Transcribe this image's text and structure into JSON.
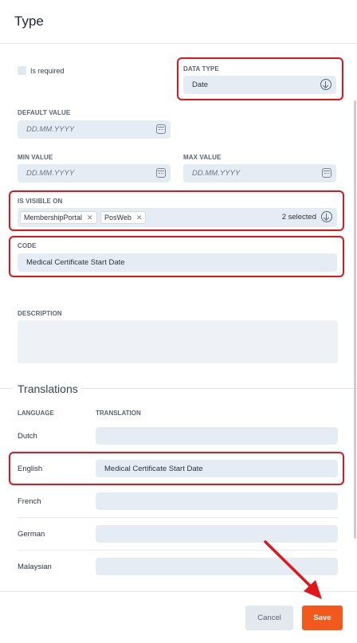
{
  "header": {
    "title": "Type"
  },
  "form": {
    "is_required_label": "Is required",
    "data_type": {
      "label": "DATA TYPE",
      "value": "Date"
    },
    "default_value": {
      "label": "DEFAULT VALUE",
      "placeholder": "DD.MM.YYYY"
    },
    "min_value": {
      "label": "MIN VALUE",
      "placeholder": "DD.MM.YYYY"
    },
    "max_value": {
      "label": "MAX VALUE",
      "placeholder": "DD.MM.YYYY"
    },
    "is_visible_on": {
      "label": "IS VISIBLE ON",
      "chips": [
        "MembershipPortal",
        "PosWeb"
      ],
      "chip_remove": "✕",
      "selected_count": "2 selected"
    },
    "code": {
      "label": "CODE",
      "value": "Medical Certificate Start Date"
    },
    "description": {
      "label": "DESCRIPTION",
      "value": ""
    }
  },
  "translations": {
    "title": "Translations",
    "headers": {
      "language": "LANGUAGE",
      "translation": "TRANSLATION"
    },
    "rows": [
      {
        "language": "Dutch",
        "translation": ""
      },
      {
        "language": "English",
        "translation": "Medical Certificate Start Date"
      },
      {
        "language": "French",
        "translation": ""
      },
      {
        "language": "German",
        "translation": ""
      },
      {
        "language": "Malaysian",
        "translation": ""
      }
    ]
  },
  "footer": {
    "cancel_label": "Cancel",
    "save_label": "Save"
  },
  "colors": {
    "highlight": "#e0161b",
    "save": "#f25a1d",
    "field": "#e6ecf3"
  },
  "icons": [
    "calendar-icon",
    "circle-arrow-down-icon",
    "close-icon"
  ]
}
